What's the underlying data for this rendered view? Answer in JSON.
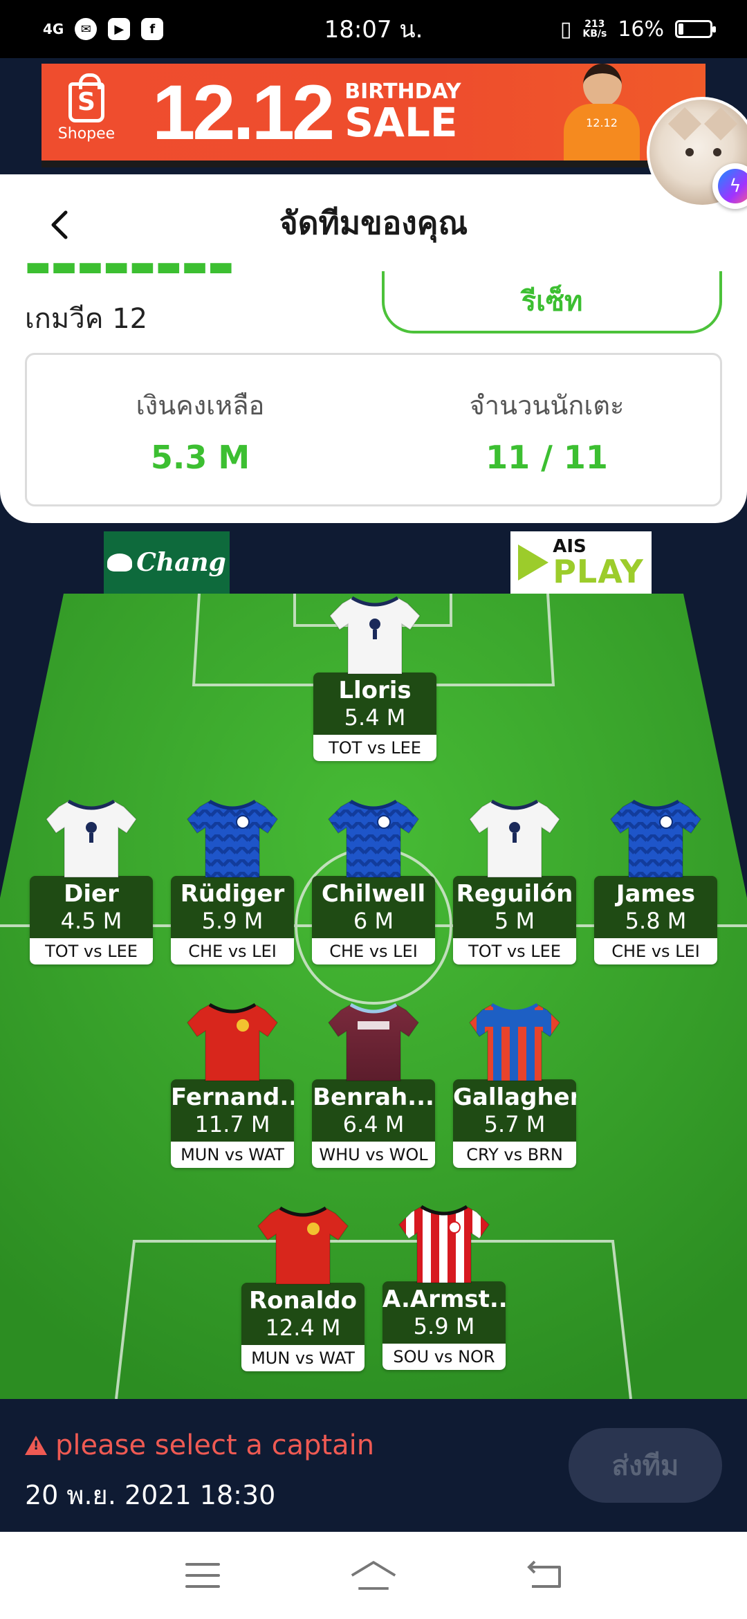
{
  "status_bar": {
    "network": "4G",
    "time": "18:07 น.",
    "speed_top": "213",
    "speed_bottom": "KB/s",
    "battery": "16%",
    "battery_level": 0.16
  },
  "banner": {
    "brand": "Shopee",
    "number": "12.12",
    "line1": "BIRTHDAY",
    "line2": "SALE",
    "shirt": "12.12"
  },
  "header": {
    "title": "จัดทีมของคุณ"
  },
  "gameweek": "เกมวีค 12",
  "reset_label": "รีเซ็ท",
  "stats": {
    "budget_label": "เงินคงเหลือ",
    "budget_value": "5.3 M",
    "players_label": "จำนวนนักเตะ",
    "players_value": "11 / 11"
  },
  "sponsors": {
    "chang": "Chang",
    "ais_top": "AIS",
    "ais_bottom": "PLAY"
  },
  "colors": {
    "accent_green": "#3cbf31",
    "dark_navy": "#0f1b33",
    "warning_red": "#ef5a53",
    "pitch_green": "#3aa82b"
  },
  "players": [
    {
      "name": "Lloris",
      "price": "5.4 M",
      "fixture": "TOT vs LEE",
      "kit": "tot"
    },
    {
      "name": "Dier",
      "price": "4.5 M",
      "fixture": "TOT vs LEE",
      "kit": "tot"
    },
    {
      "name": "Rüdiger",
      "price": "5.9 M",
      "fixture": "CHE vs LEI",
      "kit": "che"
    },
    {
      "name": "Chilwell",
      "price": "6 M",
      "fixture": "CHE vs LEI",
      "kit": "che"
    },
    {
      "name": "Reguilón",
      "price": "5 M",
      "fixture": "TOT vs LEE",
      "kit": "tot"
    },
    {
      "name": "James",
      "price": "5.8 M",
      "fixture": "CHE vs LEI",
      "kit": "che"
    },
    {
      "name": "Fernand...",
      "price": "11.7 M",
      "fixture": "MUN vs WAT",
      "kit": "mun"
    },
    {
      "name": "Benrah...",
      "price": "6.4 M",
      "fixture": "WHU vs WOL",
      "kit": "whu"
    },
    {
      "name": "Gallagher",
      "price": "5.7 M",
      "fixture": "CRY vs BRN",
      "kit": "cry"
    },
    {
      "name": "Ronaldo",
      "price": "12.4 M",
      "fixture": "MUN vs WAT",
      "kit": "mun"
    },
    {
      "name": "A.Armst...",
      "price": "5.9 M",
      "fixture": "SOU vs NOR",
      "kit": "sou"
    }
  ],
  "bottom": {
    "warning": "please select a captain",
    "deadline": "20 พ.ย. 2021 18:30",
    "submit_label": "ส่งทีม"
  },
  "nav": {
    "menu_icon": "menu-icon",
    "home_icon": "home-icon",
    "back_icon": "back-icon"
  }
}
